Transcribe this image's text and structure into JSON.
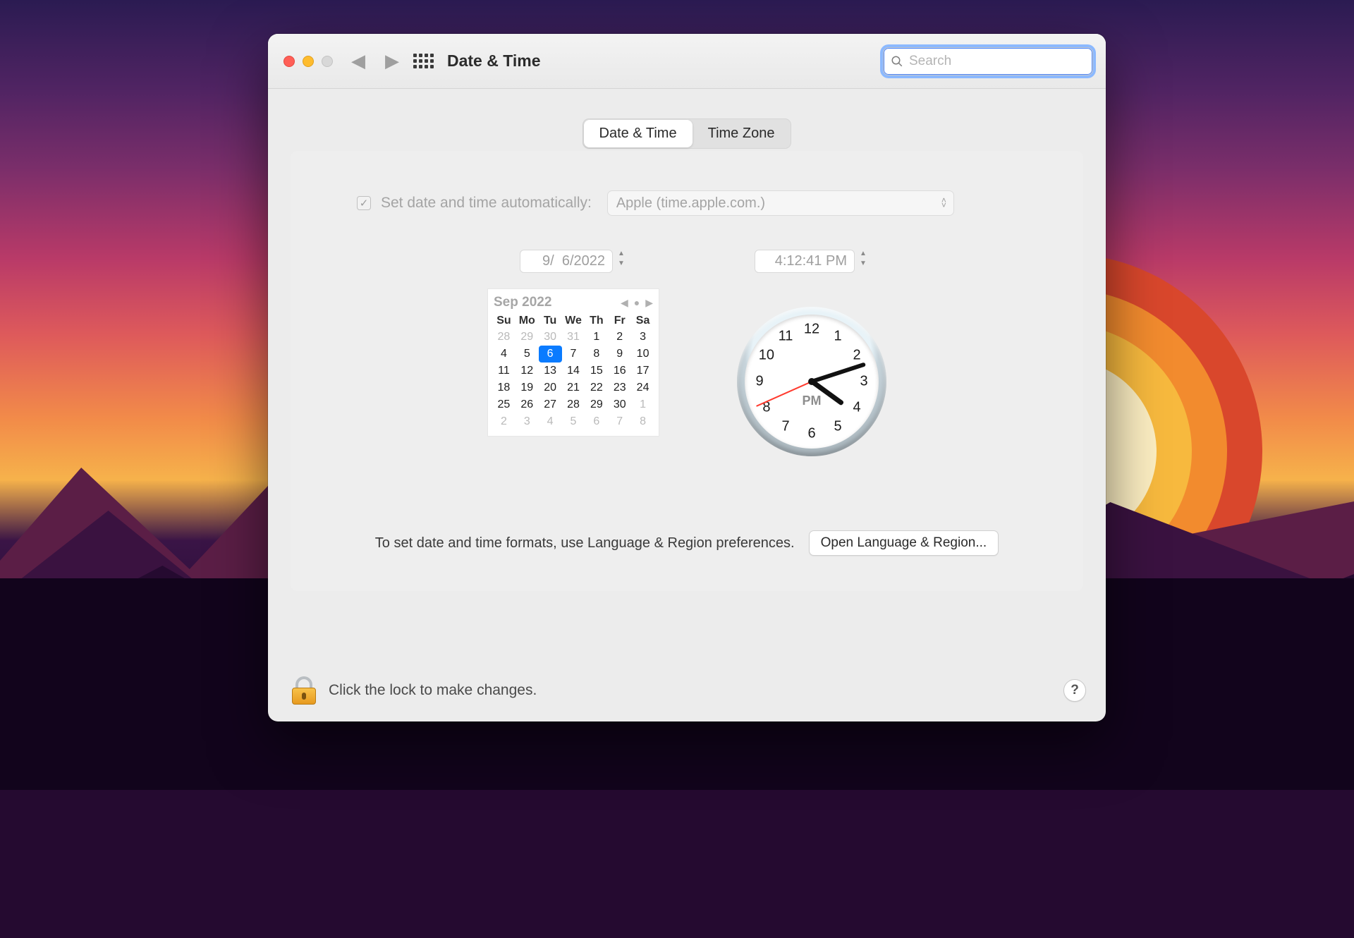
{
  "window": {
    "title": "Date & Time"
  },
  "search": {
    "placeholder": "Search",
    "value": ""
  },
  "tabs": {
    "date_time": "Date & Time",
    "time_zone": "Time Zone",
    "active": "date_time"
  },
  "auto": {
    "checked": true,
    "label": "Set date and time automatically:",
    "server": "Apple (time.apple.com.)"
  },
  "date_field": "9/  6/2022",
  "time_field": "4:12:41 PM",
  "calendar": {
    "month_label": "Sep 2022",
    "dow": [
      "Su",
      "Mo",
      "Tu",
      "We",
      "Th",
      "Fr",
      "Sa"
    ],
    "leading": [
      28,
      29,
      30,
      31
    ],
    "days": [
      1,
      2,
      3,
      4,
      5,
      6,
      7,
      8,
      9,
      10,
      11,
      12,
      13,
      14,
      15,
      16,
      17,
      18,
      19,
      20,
      21,
      22,
      23,
      24,
      25,
      26,
      27,
      28,
      29,
      30
    ],
    "trailing": [
      1,
      2,
      3,
      4,
      5,
      6,
      7,
      8
    ],
    "selected": 6
  },
  "clock": {
    "ampm": "PM",
    "hour": 4,
    "minute": 12,
    "second": 41,
    "numerals": [
      "12",
      "1",
      "2",
      "3",
      "4",
      "5",
      "6",
      "7",
      "8",
      "9",
      "10",
      "11"
    ]
  },
  "hint": {
    "text": "To set date and time formats, use Language & Region preferences.",
    "button": "Open Language & Region..."
  },
  "footer": {
    "lock_text": "Click the lock to make changes."
  }
}
